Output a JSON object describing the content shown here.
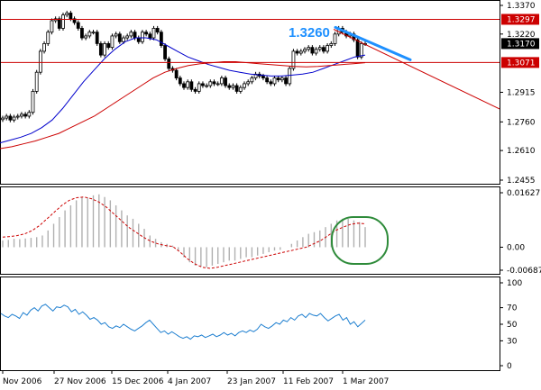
{
  "chart_data": {
    "type": "candlestick",
    "symbol_note": "",
    "x_axis": {
      "ticks": [
        "Nov 2006",
        "27 Nov 2006",
        "15 Dec 2006",
        "4 Jan 2007",
        "23 Jan 2007",
        "11 Feb 2007",
        "1 Mar 2007"
      ]
    },
    "price_panel": {
      "ylim": [
        1.2455,
        1.337
      ],
      "y_ticks": [
        "1.3370",
        "1.3220",
        "1.3170",
        "1.3071",
        "1.2915",
        "1.2760",
        "1.2610",
        "1.2455"
      ],
      "horizontal_levels": [
        {
          "label": "1.3297",
          "value": 1.3297
        },
        {
          "label": "1.3071",
          "value": 1.3071
        }
      ],
      "price_tag": {
        "label": "1.3170",
        "value": 1.317
      },
      "callout": {
        "label": "1.3260",
        "value": 1.326
      },
      "closes": [
        1.278,
        1.279,
        1.277,
        1.2785,
        1.279,
        1.28,
        1.279,
        1.281,
        1.292,
        1.302,
        1.313,
        1.317,
        1.323,
        1.329,
        1.33,
        1.325,
        1.332,
        1.333,
        1.33,
        1.328,
        1.325,
        1.32,
        1.321,
        1.323,
        1.323,
        1.317,
        1.311,
        1.317,
        1.315,
        1.321,
        1.322,
        1.318,
        1.32,
        1.321,
        1.323,
        1.32,
        1.318,
        1.323,
        1.322,
        1.32,
        1.325,
        1.323,
        1.316,
        1.309,
        1.304,
        1.303,
        1.299,
        1.296,
        1.294,
        1.297,
        1.293,
        1.292,
        1.296,
        1.295,
        1.295,
        1.297,
        1.296,
        1.296,
        1.299,
        1.295,
        1.294,
        1.295,
        1.292,
        1.294,
        1.296,
        1.297,
        1.299,
        1.301,
        1.3,
        1.299,
        1.297,
        1.296,
        1.299,
        1.298,
        1.299,
        1.296,
        1.304,
        1.313,
        1.312,
        1.313,
        1.314,
        1.315,
        1.312,
        1.314,
        1.315,
        1.313,
        1.316,
        1.317,
        1.322,
        1.325,
        1.323,
        1.321,
        1.322,
        1.319,
        1.31,
        1.317,
        1.317
      ],
      "ma_fast": [
        1.265,
        1.2665,
        1.268,
        1.27,
        1.273,
        1.277,
        1.283,
        1.29,
        1.297,
        1.303,
        1.309,
        1.314,
        1.318,
        1.32,
        1.32,
        1.319,
        1.316,
        1.313,
        1.31,
        1.308,
        1.306,
        1.3045,
        1.303,
        1.302,
        1.301,
        1.3005,
        1.3,
        1.3,
        1.3005,
        1.301,
        1.302,
        1.304,
        1.306,
        1.308,
        1.31,
        1.311
      ],
      "ma_slow": [
        1.262,
        1.263,
        1.2645,
        1.266,
        1.268,
        1.27,
        1.273,
        1.276,
        1.279,
        1.283,
        1.287,
        1.291,
        1.295,
        1.299,
        1.302,
        1.304,
        1.3055,
        1.3065,
        1.307,
        1.3075,
        1.3075,
        1.307,
        1.3065,
        1.306,
        1.3055,
        1.305,
        1.3048,
        1.305,
        1.3055,
        1.306,
        1.3065,
        1.307
      ]
    },
    "macd_panel": {
      "ylim": [
        -0.00687,
        0.01627
      ],
      "y_ticks": [
        "0.01627",
        "0.00",
        "-0.00687"
      ],
      "histogram": [
        0.002,
        0.0022,
        0.0025,
        0.0024,
        0.0026,
        0.0028,
        0.003,
        0.0035,
        0.005,
        0.007,
        0.009,
        0.011,
        0.0125,
        0.014,
        0.015,
        0.0148,
        0.0155,
        0.0158,
        0.015,
        0.014,
        0.0125,
        0.011,
        0.0095,
        0.0085,
        0.007,
        0.0055,
        0.0035,
        0.0025,
        0.0015,
        0.001,
        0.0005,
        -0.001,
        -0.003,
        -0.0045,
        -0.0055,
        -0.0058,
        -0.006,
        -0.0055,
        -0.005,
        -0.0045,
        -0.004,
        -0.004,
        -0.0035,
        -0.003,
        -0.003,
        -0.0025,
        -0.002,
        -0.0015,
        -0.001,
        -0.0008,
        0.0,
        0.001,
        0.002,
        0.003,
        0.004,
        0.0045,
        0.005,
        0.006,
        0.007,
        0.008,
        0.0085,
        0.0085,
        0.008,
        0.0075,
        0.006
      ],
      "signal": [
        0.003,
        0.0032,
        0.0035,
        0.004,
        0.005,
        0.0065,
        0.0085,
        0.0105,
        0.0125,
        0.014,
        0.0148,
        0.015,
        0.0145,
        0.0135,
        0.012,
        0.01,
        0.008,
        0.006,
        0.0045,
        0.003,
        0.0018,
        0.001,
        0.0005,
        0.0002,
        -0.0015,
        -0.0035,
        -0.005,
        -0.006,
        -0.0063,
        -0.006,
        -0.0055,
        -0.005,
        -0.0045,
        -0.004,
        -0.0035,
        -0.003,
        -0.0025,
        -0.002,
        -0.0015,
        -0.001,
        -0.0005,
        0.0,
        0.001,
        0.002,
        0.0035,
        0.005,
        0.006,
        0.0068,
        0.0072,
        0.007
      ]
    },
    "rsi_panel": {
      "ylim": [
        0,
        100
      ],
      "y_ticks": [
        "100",
        "70",
        "50",
        "30",
        "0"
      ],
      "values": [
        63,
        60,
        58,
        62,
        60,
        57,
        64,
        61,
        67,
        70,
        66,
        72,
        74,
        70,
        66,
        71,
        70,
        73,
        71,
        65,
        68,
        62,
        65,
        61,
        56,
        58,
        55,
        50,
        52,
        47,
        45,
        48,
        46,
        50,
        47,
        44,
        42,
        45,
        48,
        52,
        55,
        50,
        45,
        40,
        42,
        38,
        41,
        38,
        35,
        33,
        35,
        32,
        36,
        35,
        37,
        34,
        36,
        38,
        35,
        37,
        40,
        37,
        39,
        36,
        40,
        42,
        40,
        43,
        41,
        44,
        50,
        47,
        45,
        48,
        52,
        50,
        55,
        53,
        58,
        55,
        60,
        62,
        58,
        63,
        61,
        60,
        63,
        58,
        54,
        57,
        60,
        62,
        55,
        58,
        50,
        53,
        47,
        51,
        55
      ]
    }
  },
  "colors": {
    "candles": "#000000",
    "ma_fast": "#0000cc",
    "ma_slow": "#cc0000",
    "hline": "#cc0000",
    "tag_bg": "#cc0000",
    "trendline": "#1e90ff",
    "support_line": "#cc0000",
    "macd_hist": "#b0b0b0",
    "macd_signal": "#cc0000",
    "rsi": "#1e7fd0",
    "highlight_ring": "#2e8b3a"
  }
}
